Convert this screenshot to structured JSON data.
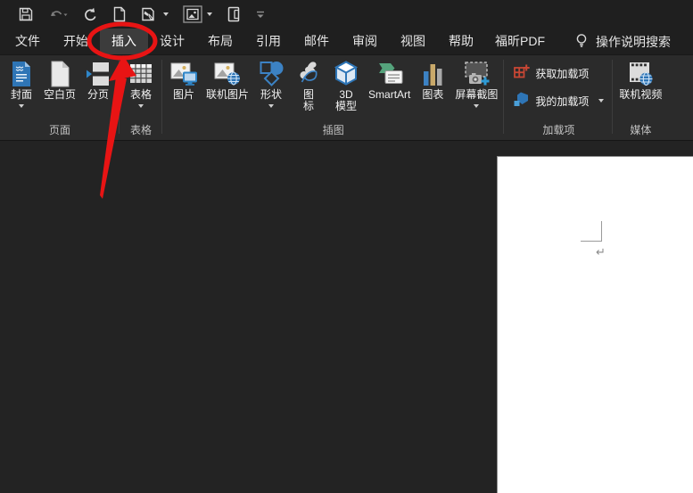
{
  "colors": {
    "topbar_bg": "#1f1f1f",
    "ribbon_bg": "#2b2b2b",
    "canvas_bg": "#232323",
    "page_bg": "#ffffff",
    "accent_blue": "#2e75b6",
    "addin_orange": "#c74634",
    "smartart_green": "#55a37c",
    "annotation_red": "#e81414"
  },
  "quick_access_toolbar": {
    "icons": [
      "save-icon",
      "undo-icon",
      "redo-icon",
      "new-document-icon",
      "ink-tool-icon",
      "insert-object-icon",
      "copy-document-icon",
      "customize-qat-icon"
    ]
  },
  "tabs": {
    "items": [
      {
        "label": "文件",
        "selected": false
      },
      {
        "label": "开始",
        "selected": false
      },
      {
        "label": "插入",
        "selected": true
      },
      {
        "label": "设计",
        "selected": false
      },
      {
        "label": "布局",
        "selected": false
      },
      {
        "label": "引用",
        "selected": false
      },
      {
        "label": "邮件",
        "selected": false
      },
      {
        "label": "审阅",
        "selected": false
      },
      {
        "label": "视图",
        "selected": false
      },
      {
        "label": "帮助",
        "selected": false
      },
      {
        "label": "福昕PDF",
        "selected": false
      }
    ],
    "assistant": {
      "icon": "lightbulb-icon",
      "label": "操作说明搜索"
    }
  },
  "ribbon": {
    "groups": [
      {
        "label": "页面",
        "buttons": [
          {
            "lines": [
              "封面"
            ],
            "dropdown": true,
            "icon": "cover-page-icon"
          },
          {
            "lines": [
              "空白页"
            ],
            "dropdown": false,
            "icon": "blank-page-icon"
          },
          {
            "lines": [
              "分页"
            ],
            "dropdown": false,
            "icon": "page-break-icon"
          }
        ]
      },
      {
        "label": "表格",
        "buttons": [
          {
            "lines": [
              "表格"
            ],
            "dropdown": true,
            "icon": "table-icon"
          }
        ]
      },
      {
        "label": "插图",
        "buttons": [
          {
            "lines": [
              "图片"
            ],
            "dropdown": false,
            "icon": "picture-icon"
          },
          {
            "lines": [
              "联机图片"
            ],
            "dropdown": false,
            "icon": "online-pictures-icon"
          },
          {
            "lines": [
              "形状"
            ],
            "dropdown": true,
            "icon": "shapes-icon"
          },
          {
            "lines": [
              "图",
              "标"
            ],
            "dropdown": false,
            "icon": "icons-icon"
          },
          {
            "lines": [
              "3D",
              "模型"
            ],
            "dropdown": true,
            "icon": "3d-models-icon"
          },
          {
            "lines": [
              "SmartArt"
            ],
            "dropdown": false,
            "icon": "smartart-icon"
          },
          {
            "lines": [
              "图表"
            ],
            "dropdown": false,
            "icon": "chart-icon"
          },
          {
            "lines": [
              "屏幕截图"
            ],
            "dropdown": true,
            "icon": "screenshot-icon"
          }
        ]
      },
      {
        "label": "加载项",
        "buttons": [
          {
            "lines": [
              "获取加载项"
            ],
            "dropdown": false,
            "icon": "get-addins-icon"
          },
          {
            "lines": [
              "我的加载项"
            ],
            "dropdown": true,
            "icon": "my-addins-icon"
          }
        ]
      },
      {
        "label": "媒体",
        "buttons": [
          {
            "lines": [
              "联机视频"
            ],
            "dropdown": false,
            "icon": "online-video-icon"
          }
        ]
      }
    ]
  },
  "document": {
    "paragraph_mark": "↵"
  },
  "annotation": {
    "type": "circle-and-arrow",
    "color": "#e81414",
    "target": "插入"
  }
}
